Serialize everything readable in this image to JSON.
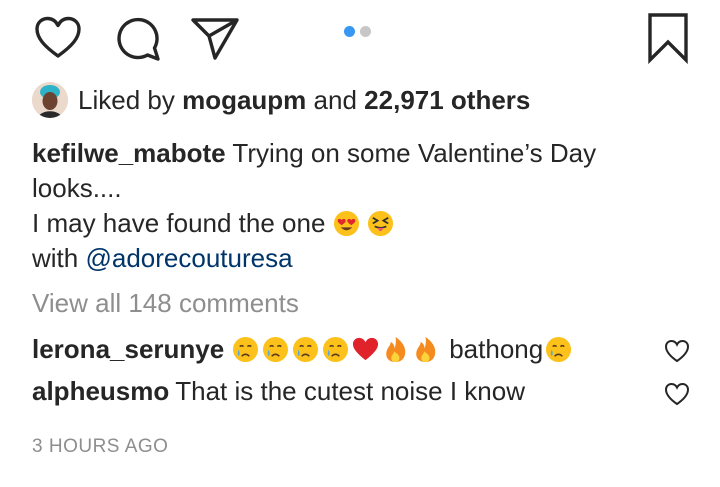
{
  "actions": {
    "like_icon": "heart-outline-icon",
    "comment_icon": "speech-bubble-icon",
    "share_icon": "paper-plane-icon",
    "save_icon": "bookmark-icon"
  },
  "carousel": {
    "total": 2,
    "active": 1,
    "active_color": "#3897f0",
    "inactive_color": "#c7c7c7"
  },
  "likes": {
    "prefix": "Liked by",
    "user": "mogaupm",
    "connector": "and",
    "others": "22,971 others"
  },
  "caption": {
    "username": "kefilwe_mabote",
    "line1": "Trying on some Valentine’s Day",
    "line2": "looks....",
    "line3": "I may have found the one",
    "line4_prefix": "with",
    "mention": "@adorecouturesa",
    "emojis": [
      "heart-eyes-emoji",
      "squinting-tongue-emoji"
    ]
  },
  "view_all": "View all 148 comments",
  "comments": [
    {
      "username": "lerona_serunye",
      "text": "bathong",
      "emojis_before": [
        "crying-face-emoji",
        "crying-face-emoji",
        "crying-face-emoji",
        "crying-face-emoji",
        "red-heart-emoji",
        "fire-emoji",
        "fire-emoji"
      ],
      "emojis_after": [
        "crying-face-emoji"
      ]
    },
    {
      "username": "alpheusmo",
      "text": "That is the cutest noise I know"
    }
  ],
  "timestamp": "3 HOURS AGO"
}
